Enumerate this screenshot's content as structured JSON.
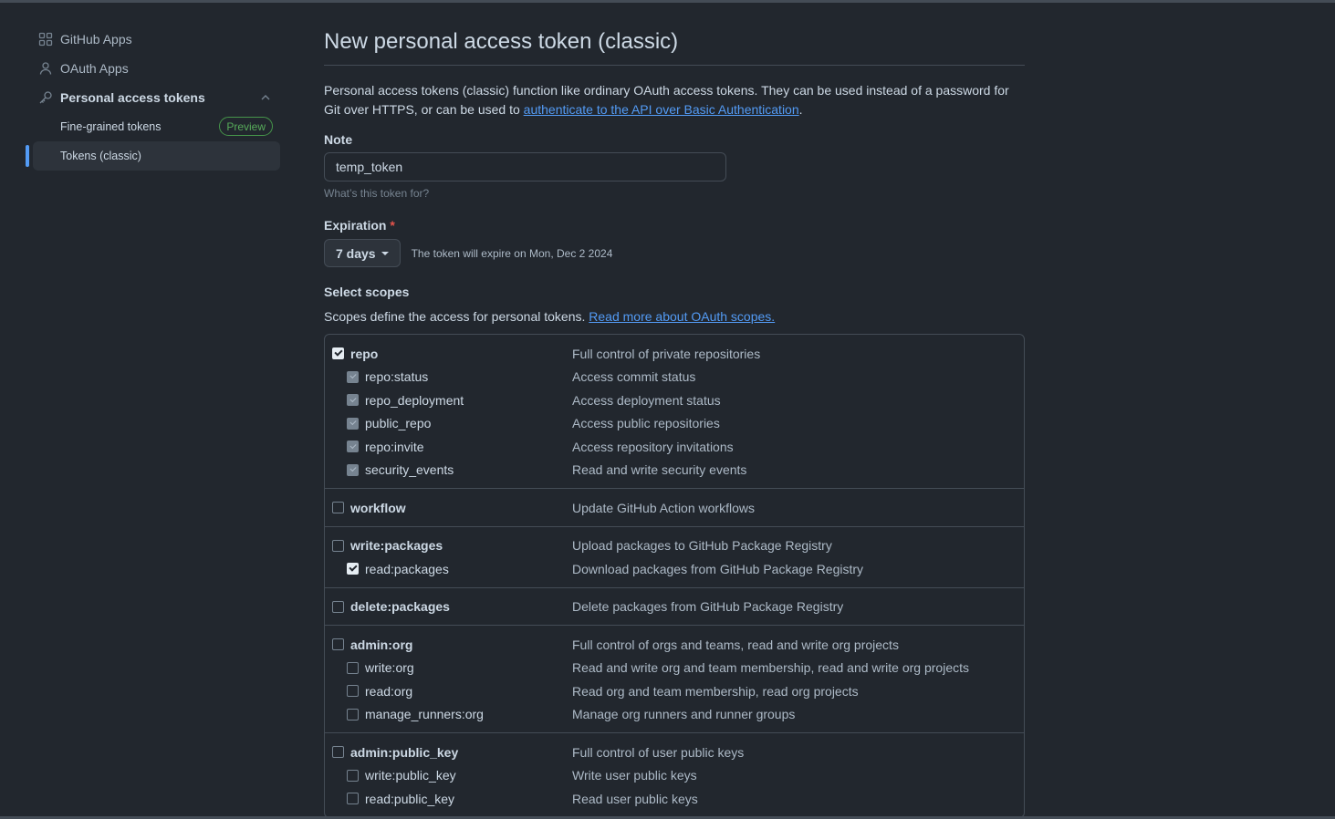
{
  "sidebar": {
    "items": [
      {
        "label": "GitHub Apps",
        "icon": "apps-grid-icon"
      },
      {
        "label": "OAuth Apps",
        "icon": "person-icon"
      },
      {
        "label": "Personal access tokens",
        "icon": "key-icon"
      }
    ],
    "sub_items": [
      {
        "label": "Fine-grained tokens",
        "badge": "Preview"
      },
      {
        "label": "Tokens (classic)"
      }
    ]
  },
  "main": {
    "title": "New personal access token (classic)",
    "intro_text": "Personal access tokens (classic) function like ordinary OAuth access tokens. They can be used instead of a password for Git over HTTPS, or can be used to ",
    "intro_link": "authenticate to the API over Basic Authentication",
    "intro_end": ".",
    "note_label": "Note",
    "note_value": "temp_token",
    "note_hint": "What’s this token for?",
    "expiration_label": "Expiration",
    "required_mark": "*",
    "expiration_value": "7 days",
    "expiration_note": "The token will expire on Mon, Dec 2 2024",
    "scopes_label": "Select scopes",
    "scopes_desc": "Scopes define the access for personal tokens. ",
    "scopes_link": "Read more about OAuth scopes."
  },
  "scope_groups": [
    {
      "rows": [
        {
          "name": "repo",
          "desc": "Full control of private repositories",
          "level": "top",
          "state": "checked"
        },
        {
          "name": "repo:status",
          "desc": "Access commit status",
          "level": "sub",
          "state": "disabled"
        },
        {
          "name": "repo_deployment",
          "desc": "Access deployment status",
          "level": "sub",
          "state": "disabled"
        },
        {
          "name": "public_repo",
          "desc": "Access public repositories",
          "level": "sub",
          "state": "disabled"
        },
        {
          "name": "repo:invite",
          "desc": "Access repository invitations",
          "level": "sub",
          "state": "disabled"
        },
        {
          "name": "security_events",
          "desc": "Read and write security events",
          "level": "sub",
          "state": "disabled"
        }
      ]
    },
    {
      "rows": [
        {
          "name": "workflow",
          "desc": "Update GitHub Action workflows",
          "level": "top",
          "state": "unchecked"
        }
      ]
    },
    {
      "rows": [
        {
          "name": "write:packages",
          "desc": "Upload packages to GitHub Package Registry",
          "level": "top",
          "state": "unchecked"
        },
        {
          "name": "read:packages",
          "desc": "Download packages from GitHub Package Registry",
          "level": "sub",
          "state": "checked"
        }
      ]
    },
    {
      "rows": [
        {
          "name": "delete:packages",
          "desc": "Delete packages from GitHub Package Registry",
          "level": "top",
          "state": "unchecked"
        }
      ]
    },
    {
      "rows": [
        {
          "name": "admin:org",
          "desc": "Full control of orgs and teams, read and write org projects",
          "level": "top",
          "state": "unchecked"
        },
        {
          "name": "write:org",
          "desc": "Read and write org and team membership, read and write org projects",
          "level": "sub",
          "state": "unchecked"
        },
        {
          "name": "read:org",
          "desc": "Read org and team membership, read org projects",
          "level": "sub",
          "state": "unchecked"
        },
        {
          "name": "manage_runners:org",
          "desc": "Manage org runners and runner groups",
          "level": "sub",
          "state": "unchecked"
        }
      ]
    },
    {
      "rows": [
        {
          "name": "admin:public_key",
          "desc": "Full control of user public keys",
          "level": "top",
          "state": "unchecked"
        },
        {
          "name": "write:public_key",
          "desc": "Write user public keys",
          "level": "sub",
          "state": "unchecked"
        },
        {
          "name": "read:public_key",
          "desc": "Read user public keys",
          "level": "sub",
          "state": "unchecked"
        }
      ]
    }
  ],
  "colors": {
    "background": "#22272e",
    "accent": "#539bf5",
    "border": "#444c56",
    "badge_green": "#57ab5a",
    "required_red": "#e5534b"
  }
}
